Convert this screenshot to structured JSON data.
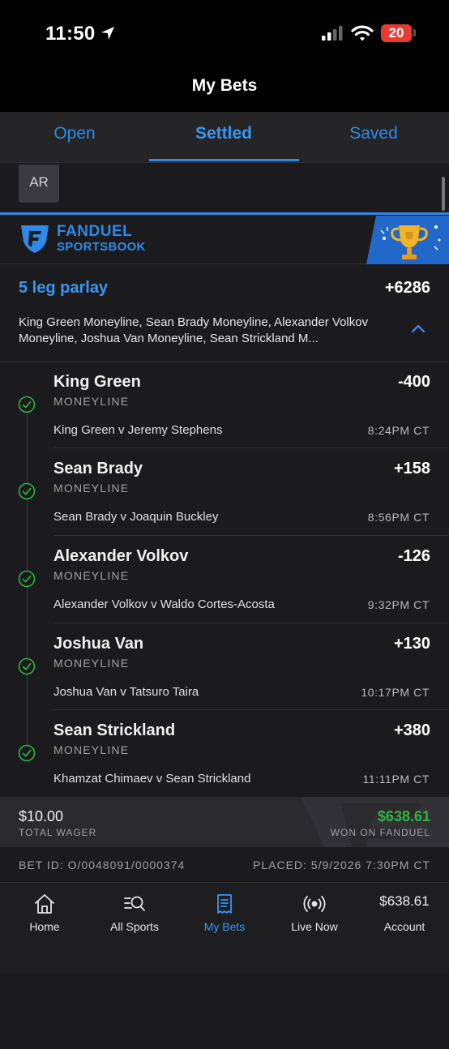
{
  "status_bar": {
    "time": "11:50",
    "battery": "20"
  },
  "header": {
    "title": "My Bets"
  },
  "tabs": [
    {
      "label": "Open"
    },
    {
      "label": "Settled"
    },
    {
      "label": "Saved"
    }
  ],
  "active_tab": "Settled",
  "filter_chip": "AR",
  "brand": {
    "name": "FANDUEL",
    "sub": "SPORTSBOOK"
  },
  "parlay": {
    "title": "5 leg parlay",
    "odds": "+6286",
    "description": "King Green Moneyline, Sean Brady Moneyline, Alexander Volkov Moneyline, Joshua Van Moneyline, Sean Strickland M..."
  },
  "legs": [
    {
      "name": "King Green",
      "type": "MONEYLINE",
      "odds": "-400",
      "match": "King Green v Jeremy Stephens",
      "time": "8:24PM CT"
    },
    {
      "name": "Sean Brady",
      "type": "MONEYLINE",
      "odds": "+158",
      "match": "Sean Brady v Joaquin Buckley",
      "time": "8:56PM CT"
    },
    {
      "name": "Alexander Volkov",
      "type": "MONEYLINE",
      "odds": "-126",
      "match": "Alexander Volkov v Waldo Cortes-Acosta",
      "time": "9:32PM CT"
    },
    {
      "name": "Joshua Van",
      "type": "MONEYLINE",
      "odds": "+130",
      "match": "Joshua Van v Tatsuro Taira",
      "time": "10:17PM CT"
    },
    {
      "name": "Sean Strickland",
      "type": "MONEYLINE",
      "odds": "+380",
      "match": "Khamzat Chimaev v Sean Strickland",
      "time": "11:11PM CT"
    }
  ],
  "totals": {
    "wager_amount": "$10.00",
    "wager_label": "TOTAL WAGER",
    "won_amount": "$638.61",
    "won_label": "WON ON FANDUEL"
  },
  "bet_meta": {
    "bet_id": "BET ID: O/0048091/0000374",
    "placed": "PLACED: 5/9/2026 7:30PM CT"
  },
  "nav": [
    {
      "label": "Home",
      "icon": "home-icon"
    },
    {
      "label": "All Sports",
      "icon": "search-sports-icon"
    },
    {
      "label": "My Bets",
      "icon": "bet-slip-icon"
    },
    {
      "label": "Live Now",
      "icon": "live-icon"
    },
    {
      "label": "Account",
      "balance": "$638.61"
    }
  ],
  "colors": {
    "accent": "#2e8ae6",
    "win": "#2fb344",
    "battery": "#ea3a32"
  }
}
